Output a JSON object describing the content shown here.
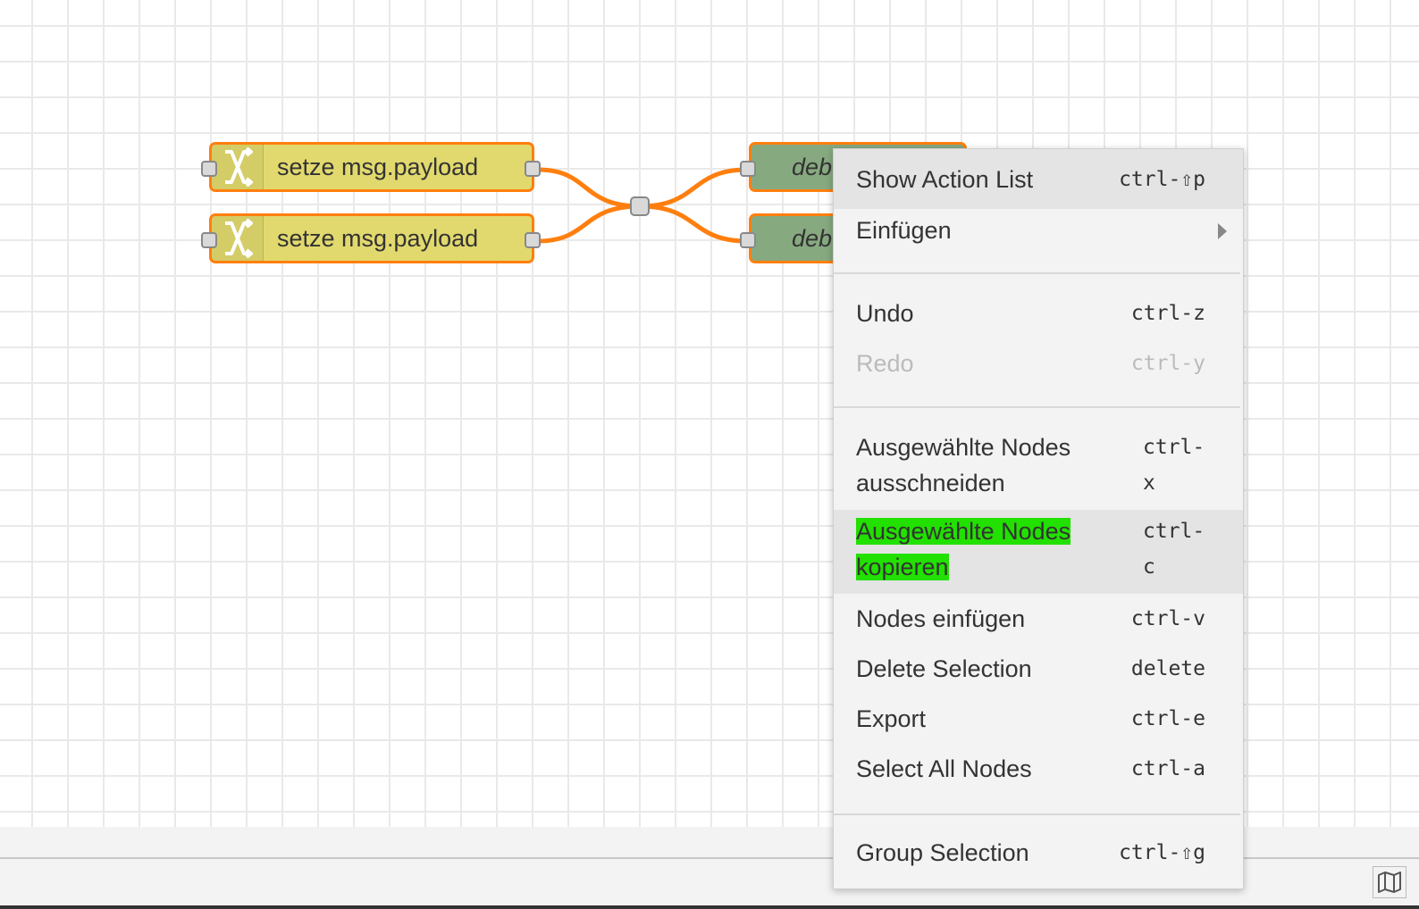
{
  "nodes": {
    "change_1": {
      "label": "setze msg.payload",
      "icon": "shuffle-icon"
    },
    "change_2": {
      "label": "setze msg.payload",
      "icon": "shuffle-icon"
    },
    "debug_1": {
      "label": "deb"
    },
    "debug_2": {
      "label": "deb"
    }
  },
  "context_menu": {
    "items": [
      {
        "label": "Show Action List",
        "shortcut": "ctrl-⇧p"
      },
      {
        "label": "Einfügen",
        "shortcut": ""
      },
      {
        "label": "Undo",
        "shortcut": "ctrl-z"
      },
      {
        "label": "Redo",
        "shortcut": "ctrl-y"
      },
      {
        "label_line1": "Ausgewählte Nodes",
        "label_line2": "ausschneiden",
        "shortcut_line1": "ctrl-",
        "shortcut_line2": "x"
      },
      {
        "label_line1": "Ausgewählte Nodes",
        "label_line2": "kopieren",
        "shortcut_line1": "ctrl-",
        "shortcut_line2": "c"
      },
      {
        "label": "Nodes einfügen",
        "shortcut": "ctrl-v"
      },
      {
        "label": "Delete Selection",
        "shortcut": "delete"
      },
      {
        "label": "Export",
        "shortcut": "ctrl-e"
      },
      {
        "label": "Select All Nodes",
        "shortcut": "ctrl-a"
      },
      {
        "label": "Group Selection",
        "shortcut": "ctrl-⇧g"
      }
    ]
  },
  "colors": {
    "wire": "#ff7f0e",
    "change_node": "#e2d96e",
    "debug_node": "#87a980",
    "highlight": "#22e000"
  },
  "footer": {
    "map_icon": "map-icon"
  }
}
